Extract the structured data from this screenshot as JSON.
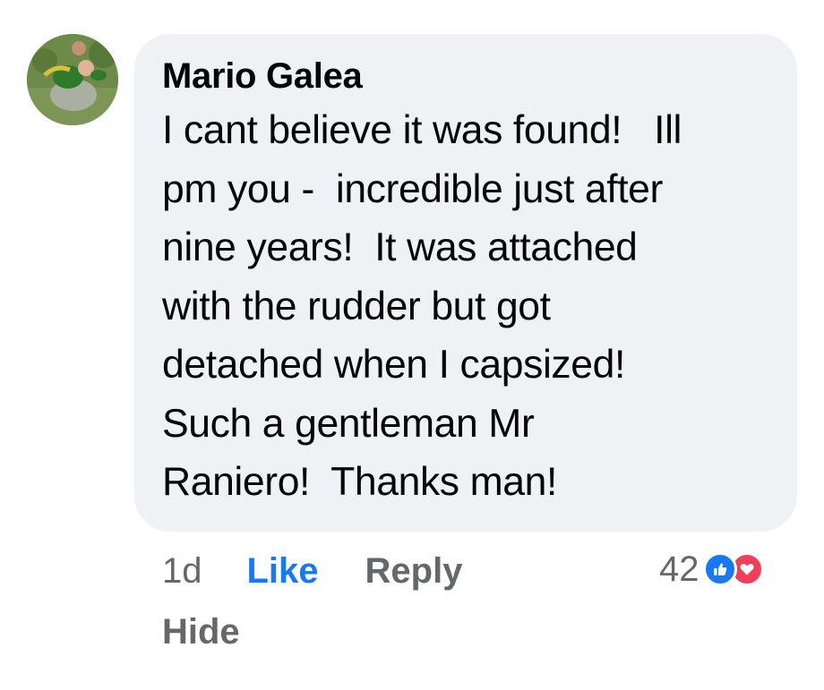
{
  "comment": {
    "author": "Mario Galea",
    "text": "I cant believe it was found!   Ill\npm you -  incredible just after\nnine years!  It was attached\nwith the rudder but got\ndetached when I capsized!\nSuch a gentleman Mr\nRaniero!  Thanks man!",
    "timestamp": "1d"
  },
  "actions": {
    "like_label": "Like",
    "reply_label": "Reply",
    "hide_label": "Hide"
  },
  "reactions": {
    "count": "42",
    "icons": [
      "thumbs-up-icon",
      "heart-icon"
    ],
    "like_color": "#1877f2",
    "love_color": "#f33e58"
  },
  "colors": {
    "bubble_bg": "#eff1f5",
    "text_primary": "#050505",
    "text_secondary": "#65676b",
    "accent": "#1877f2"
  }
}
